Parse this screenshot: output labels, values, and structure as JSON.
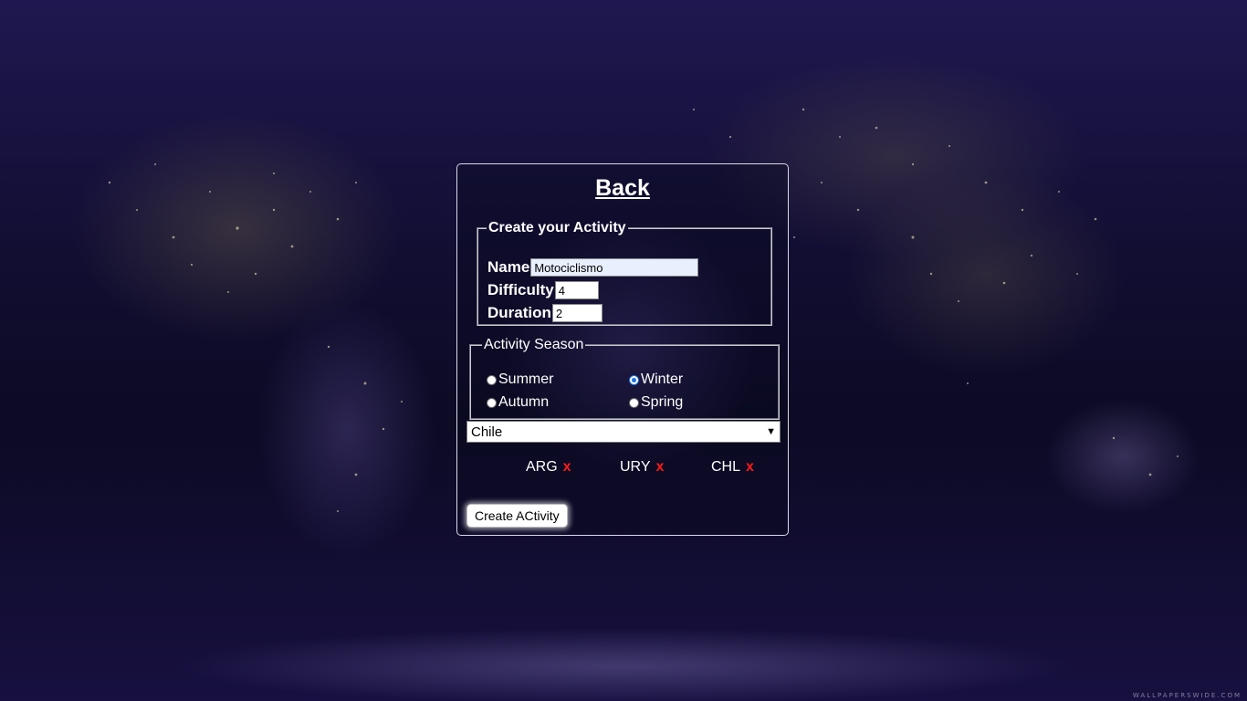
{
  "nav": {
    "back_label": "Back"
  },
  "activity_form": {
    "legend": "Create your Activity",
    "name_label": "Name",
    "name_value": "Motociclismo",
    "difficulty_label": "Difficulty",
    "difficulty_value": "4",
    "duration_label": "Duration",
    "duration_value": "2"
  },
  "season": {
    "legend": "Activity Season",
    "options": [
      {
        "label": "Summer",
        "checked": false
      },
      {
        "label": "Winter",
        "checked": true
      },
      {
        "label": "Autumn",
        "checked": false
      },
      {
        "label": "Spring",
        "checked": false
      }
    ]
  },
  "country_select": {
    "selected": "Chile"
  },
  "selected_countries": [
    {
      "code": "ARG",
      "remove": "x"
    },
    {
      "code": "URY",
      "remove": "x"
    },
    {
      "code": "CHL",
      "remove": "x"
    }
  ],
  "submit": {
    "label": "Create ACtivity"
  },
  "background": {
    "watermark": "WALLPAPERSWIDE.COM"
  },
  "colors": {
    "remove_x": "#ff1a1a",
    "radio_checked": "#1a73e8",
    "background_dark": "#120e33"
  }
}
